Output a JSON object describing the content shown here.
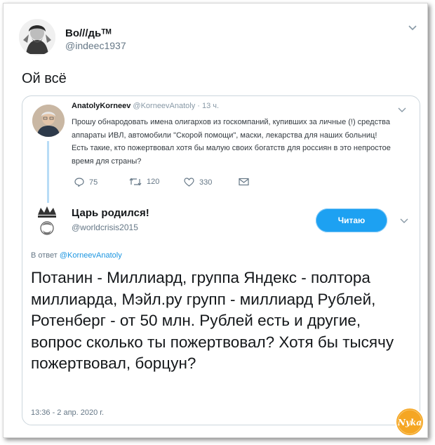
{
  "outer_tweet": {
    "author_name": "Во///дьᵀᴹ",
    "handle": "@indeec1937",
    "text": "Ой всё"
  },
  "quoted_tweet": {
    "author_name": "AnatolyKorneev",
    "meta": " @KorneevAnatoly · 13 ч.",
    "text": "Прошу обнародовать имена олигархов из госкомпаний, купивших за личные (!) средства аппараты ИВЛ, автомобили \"Скорой помощи\", маски, лекарства для наших больниц! Есть такие, кто пожертвовал хотя бы малую своих богатств для россиян в это непростое время для страны?",
    "actions": {
      "replies": "75",
      "retweets": "120",
      "likes": "330"
    }
  },
  "reply_tweet": {
    "author_name": "Царь родился!",
    "handle": "@worldcrisis2015",
    "follow_label": "Читаю",
    "reply_prefix": "В ответ ",
    "reply_to": "@KorneevAnatoly",
    "text": "Потанин - Миллиард, группа Яндекс - полтора миллиарда, Мэйл.ру групп - миллиард Рублей, Ротенберг - от 50 млн. Рублей есть и другие, вопрос сколько ты пожертвовал? Хотя бы тысячу пожертвовал, борцун?",
    "timestamp": "13:36 - 2 апр. 2020 г."
  },
  "watermark": {
    "text": "Nyka",
    "color": "#f5a623"
  },
  "colors": {
    "accent": "#1da1f2",
    "link": "#1b95e0",
    "muted": "#657786",
    "thread_line": "#b8dcf6"
  }
}
